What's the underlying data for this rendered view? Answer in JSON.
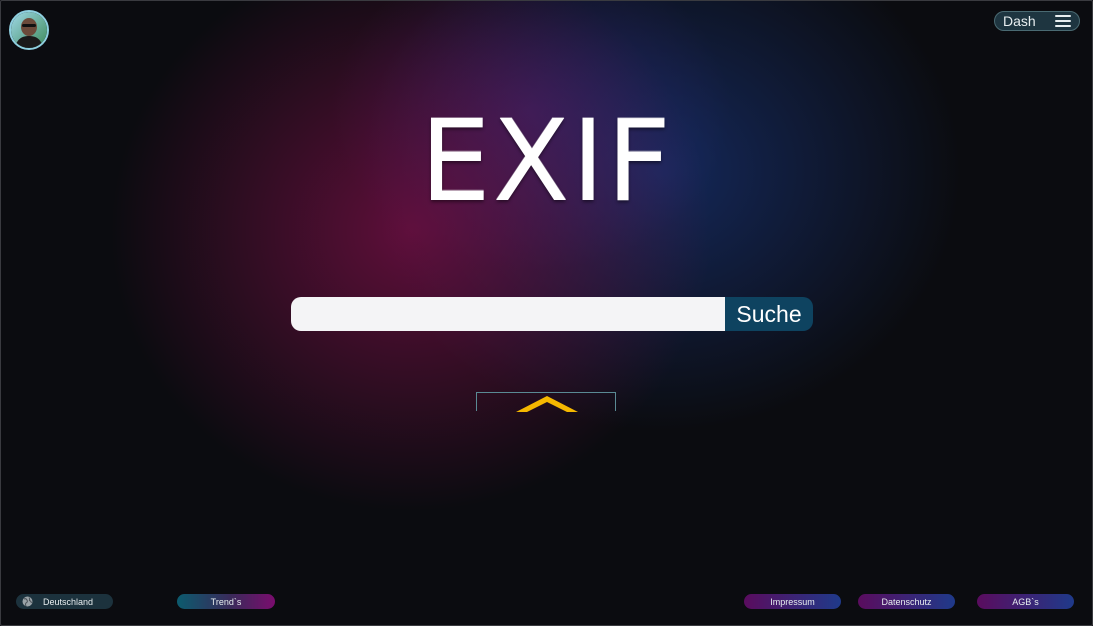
{
  "header": {
    "avatar_icon": "user-avatar",
    "dash_label": "Dash",
    "menu_icon": "hamburger-menu-icon"
  },
  "hero": {
    "logo_text": "EXIF"
  },
  "search": {
    "value": "",
    "placeholder": "",
    "button_label": "Suche"
  },
  "toggle": {
    "icon": "chevron-up-icon",
    "icon_color": "#f5b800"
  },
  "footer": {
    "country": {
      "label": "Deutschland",
      "icon": "globe-icon"
    },
    "trends": "Trend`s",
    "links": [
      "Impressum",
      "Datenschutz",
      "AGB`s"
    ]
  },
  "colors": {
    "background": "#0b0c10",
    "accent_magenta": "#820f4b",
    "accent_blue": "#193782",
    "search_button": "#0e4360"
  }
}
